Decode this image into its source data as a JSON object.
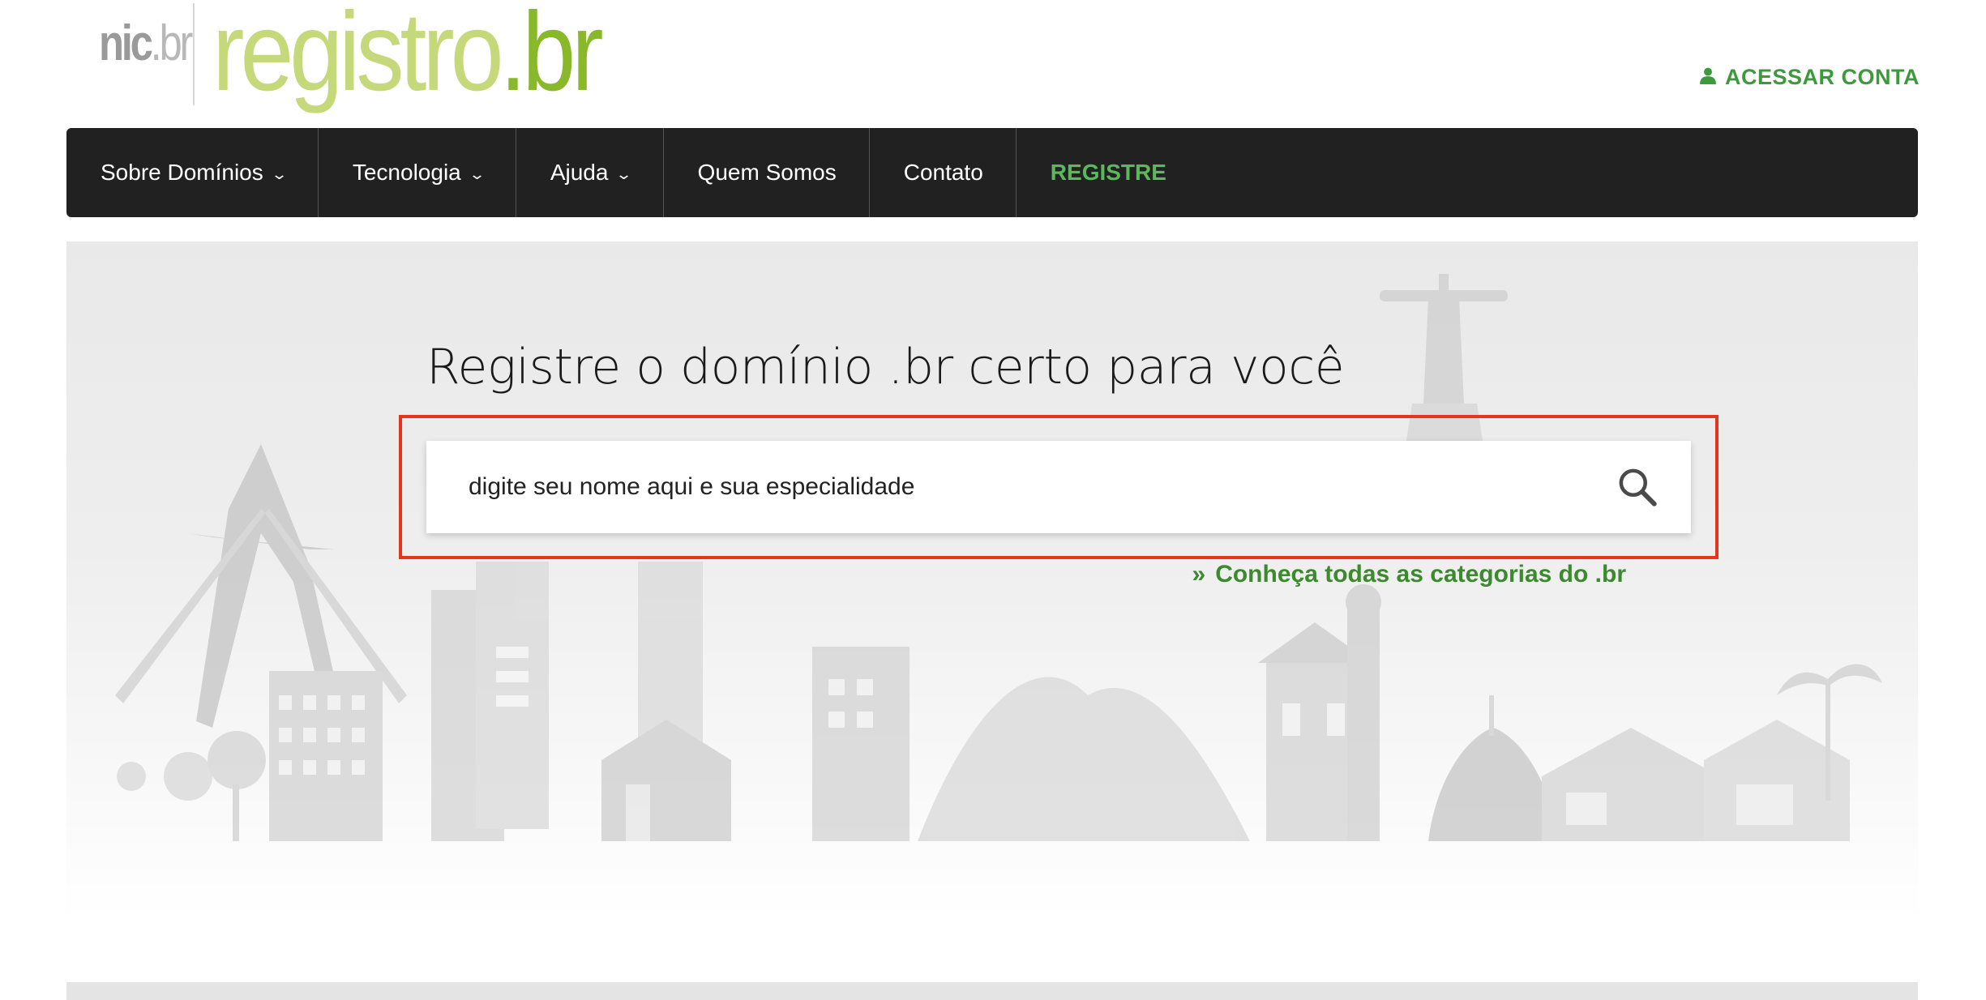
{
  "header": {
    "logo_nic": "nic.br",
    "logo_registro": "registro",
    "logo_br": ".br",
    "account_label": "ACESSAR CONTA",
    "account_icon": "user-icon"
  },
  "nav": {
    "items": [
      {
        "label": "Sobre Domínios",
        "dropdown": true
      },
      {
        "label": "Tecnologia",
        "dropdown": true
      },
      {
        "label": "Ajuda",
        "dropdown": true
      },
      {
        "label": "Quem Somos",
        "dropdown": false
      },
      {
        "label": "Contato",
        "dropdown": false
      },
      {
        "label": "REGISTRE",
        "dropdown": false
      }
    ],
    "chevron_icon": "chevron-down-icon"
  },
  "hero": {
    "title": "Registre o domínio .br certo para você",
    "search_placeholder": "digite seu nome aqui e sua especialidade",
    "search_icon": "search-icon",
    "categories_prefix": "»",
    "categories_link": "Conheça todas as categorias do .br"
  },
  "colors": {
    "nav_bg": "#212121",
    "accent_green": "#3c9a3c",
    "highlight_red": "#e8341c",
    "logo_light_green": "#c5d97a",
    "logo_dark_green": "#8ab82b"
  }
}
